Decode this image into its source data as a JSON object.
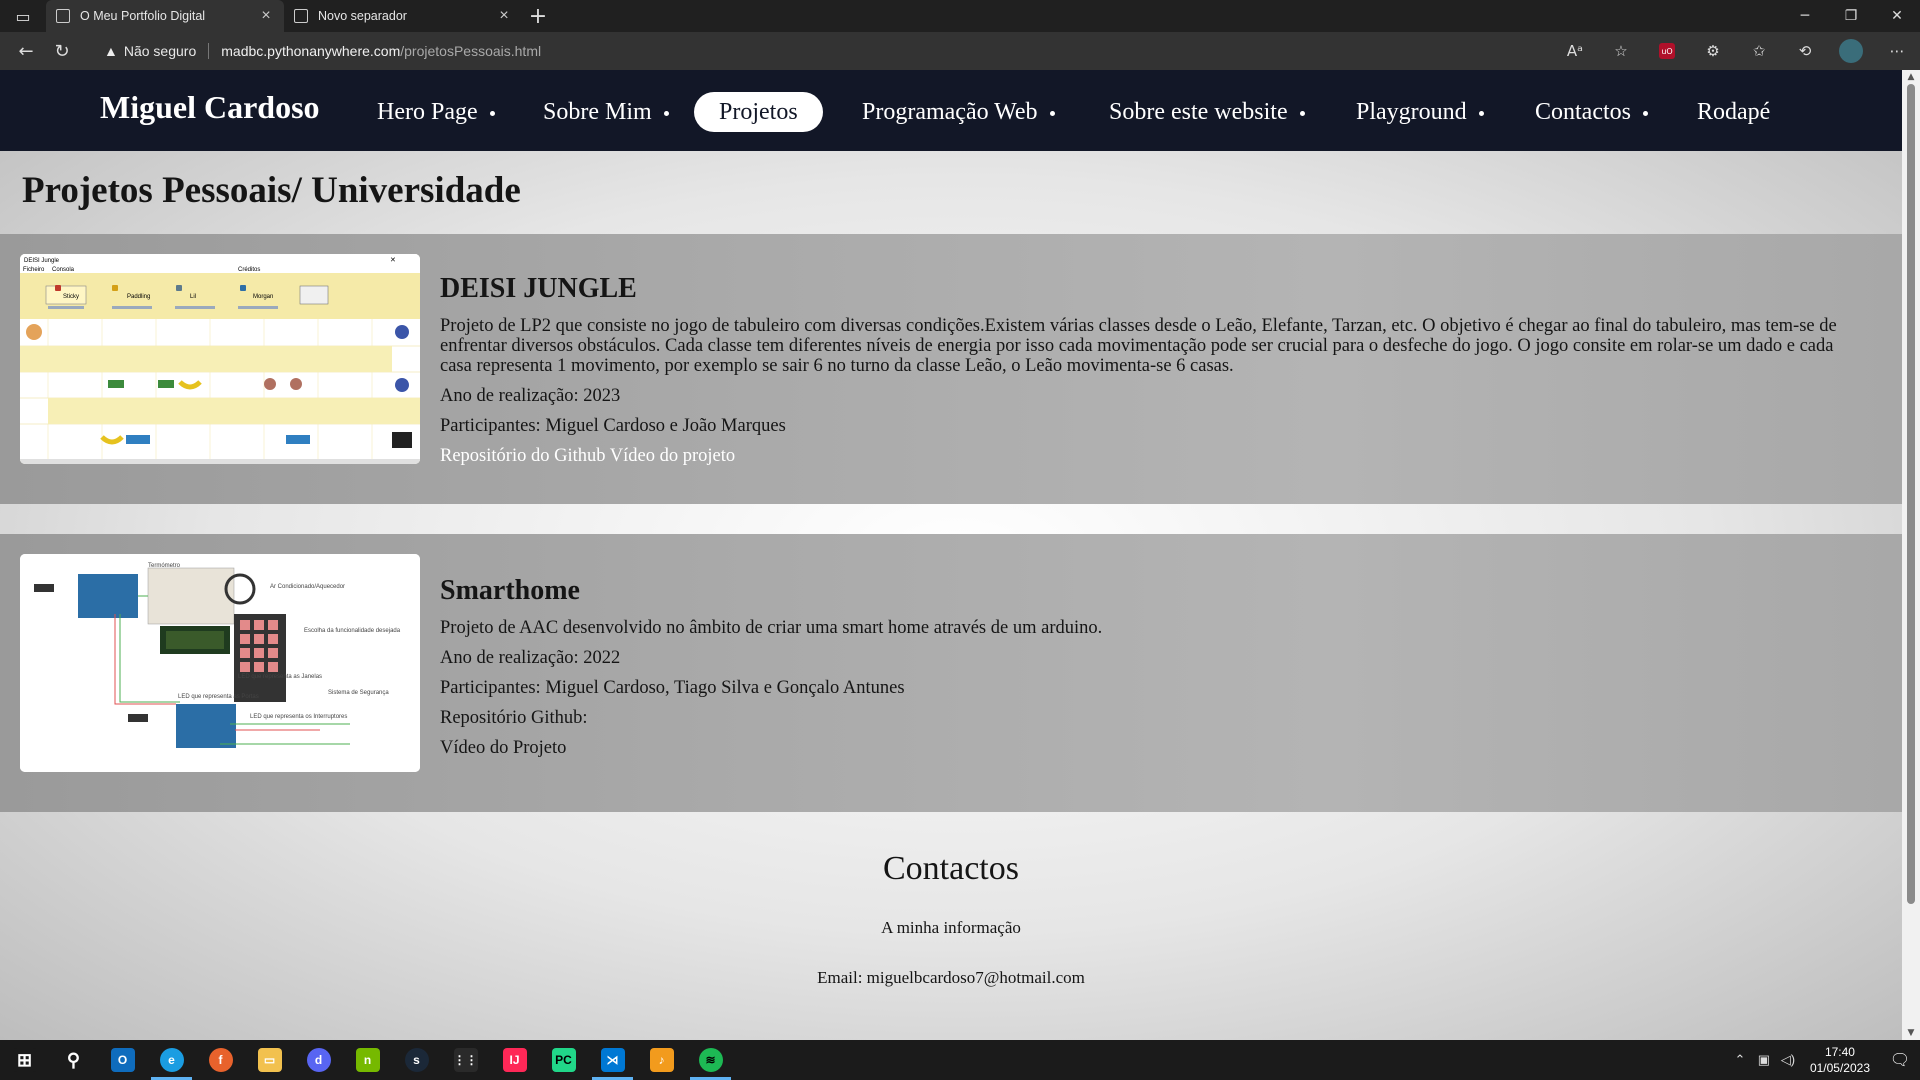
{
  "browser": {
    "tabs": [
      {
        "title": "O Meu Portfolio Digital",
        "active": true
      },
      {
        "title": "Novo separador",
        "active": false
      }
    ],
    "security_label": "Não seguro",
    "url_host": "madbc.pythonanywhere.com",
    "url_path": "/projetosPessoais.html"
  },
  "site": {
    "brand": "Miguel Cardoso",
    "nav": [
      {
        "label": "Hero Page"
      },
      {
        "label": "Sobre Mim"
      },
      {
        "label": "Projetos"
      },
      {
        "label": "Programação Web"
      },
      {
        "label": "Sobre este website"
      },
      {
        "label": "Playground"
      },
      {
        "label": "Contactos"
      },
      {
        "label": "Rodapé"
      }
    ],
    "page_title": "Projetos Pessoais/ Universidade"
  },
  "projects": [
    {
      "title": "DEISI JUNGLE",
      "description": "Projeto de LP2 que consiste no jogo de tabuleiro com diversas condições.Existem várias classes desde o Leão, Elefante, Tarzan, etc. O objetivo é chegar ao final do tabuleiro, mas tem-se de enfrentar diversos obstáculos. Cada classe tem diferentes níveis de energia por isso cada movimentação pode ser crucial para o desfeche do jogo. O jogo consite em rolar-se um dado e cada casa representa 1 movimento, por exemplo se sair 6 no turno da classe Leão, o Leão movimenta-se 6 casas.",
      "year": "Ano de realização: 2023",
      "participants": "Participantes: Miguel Cardoso e João Marques",
      "link_repo": "Repositório do Github",
      "link_video": "Vídeo do projeto",
      "screenshot": {
        "window_title": "DEISI Jungle",
        "menu": [
          "Ficheiro",
          "Consola",
          "Créditos"
        ],
        "players": [
          "Sticky",
          "Paddling",
          "Lil",
          "Morgan"
        ]
      }
    },
    {
      "title": "Smarthome",
      "description": "Projeto de AAC desenvolvido no âmbito de criar uma smart home através de um arduino.",
      "year": "Ano de realização: 2022",
      "participants": "Participantes: Miguel Cardoso, Tiago Silva e Gonçalo Antunes",
      "repo": "Repositório Github:",
      "video": "Vídeo do Projeto",
      "diagram_labels": [
        "Termómetro",
        "Ar Condicionado/Aquecedor",
        "Escolha da funcionalidade desejada",
        "LED que representa as Janelas",
        "LED que representa as Portas",
        "Sistema de Segurança",
        "LED que representa os Interruptores"
      ]
    }
  ],
  "contacts": {
    "title": "Contactos",
    "subtitle": "A minha informação",
    "email": "Email: miguelbcardoso7@hotmail.com"
  },
  "taskbar": {
    "time": "17:40",
    "date": "01/05/2023",
    "notifications": "1"
  },
  "colors": {
    "nav_bg": "#121727",
    "taskbar_bg": "#1b1b1b",
    "accent": "#5fb2f2"
  }
}
